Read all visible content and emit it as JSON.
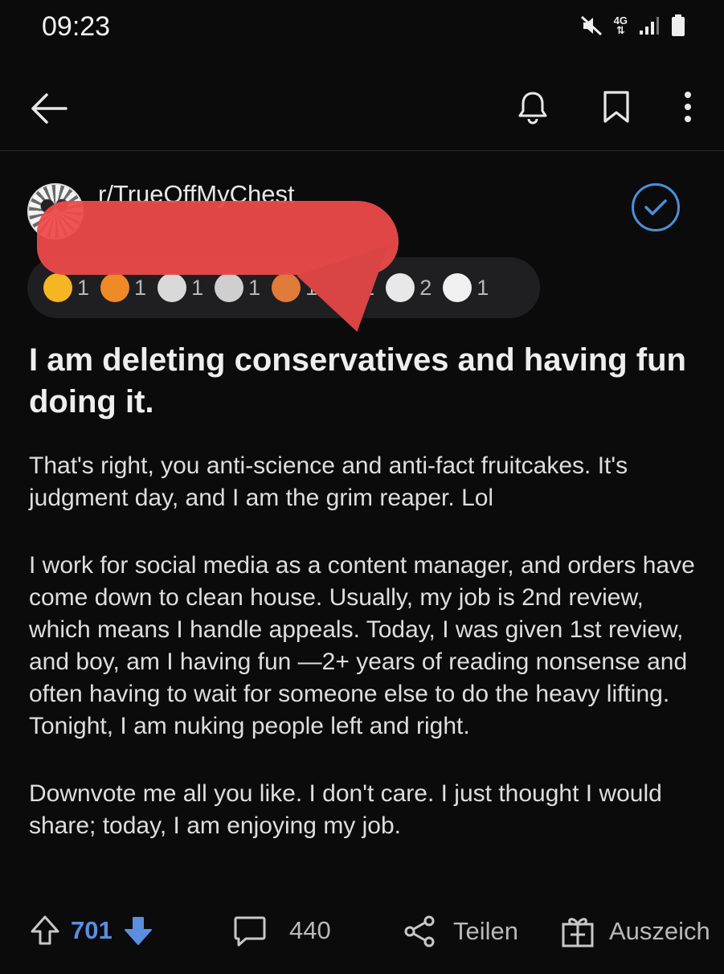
{
  "status_bar": {
    "time": "09:23",
    "network": "4G"
  },
  "post": {
    "subreddit": "r/TrueOffMyChest",
    "title": "I am deleting conservatives and having fun doing it.",
    "body": [
      "That's right, you anti-science and anti-fact fruitcakes. It's judgment day, and I am the grim reaper. Lol",
      "I work for social media as a content manager, and orders have come down to clean house. Usually, my job is 2nd review, which means I handle appeals. Today, I was given 1st review, and boy, am I having fun —2+ years of reading nonsense and often having to wait for someone else to do the heavy lifting. Tonight, I am nuking people left and right.",
      "Downvote me all you like. I don't care. I just thought I would share; today, I am enjoying my job."
    ],
    "awards": [
      {
        "icon": "gold-award-icon",
        "count": "1",
        "color": "#f5b623"
      },
      {
        "icon": "sun-award-icon",
        "count": "1",
        "color": "#f08a24"
      },
      {
        "icon": "heart-award-icon",
        "count": "1",
        "color": "#d9d9d9"
      },
      {
        "icon": "swirl-award-icon",
        "count": "1",
        "color": "#cfcfcf"
      },
      {
        "icon": "house-award-icon",
        "count": "1",
        "color": "#e07b3a"
      },
      {
        "icon": "gem-award-icon",
        "count": "1",
        "color": "#6fb3a8"
      },
      {
        "icon": "hands-award-icon",
        "count": "2",
        "color": "#e8e8e8"
      },
      {
        "icon": "face-award-icon",
        "count": "1",
        "color": "#f0f0f0"
      }
    ]
  },
  "actions": {
    "votes": "701",
    "comments": "440",
    "share_label": "Teilen",
    "award_label": "Auszeich"
  },
  "colors": {
    "accent": "#5a8fe0",
    "verified": "#4a90d9",
    "background": "#0b0b0c"
  }
}
